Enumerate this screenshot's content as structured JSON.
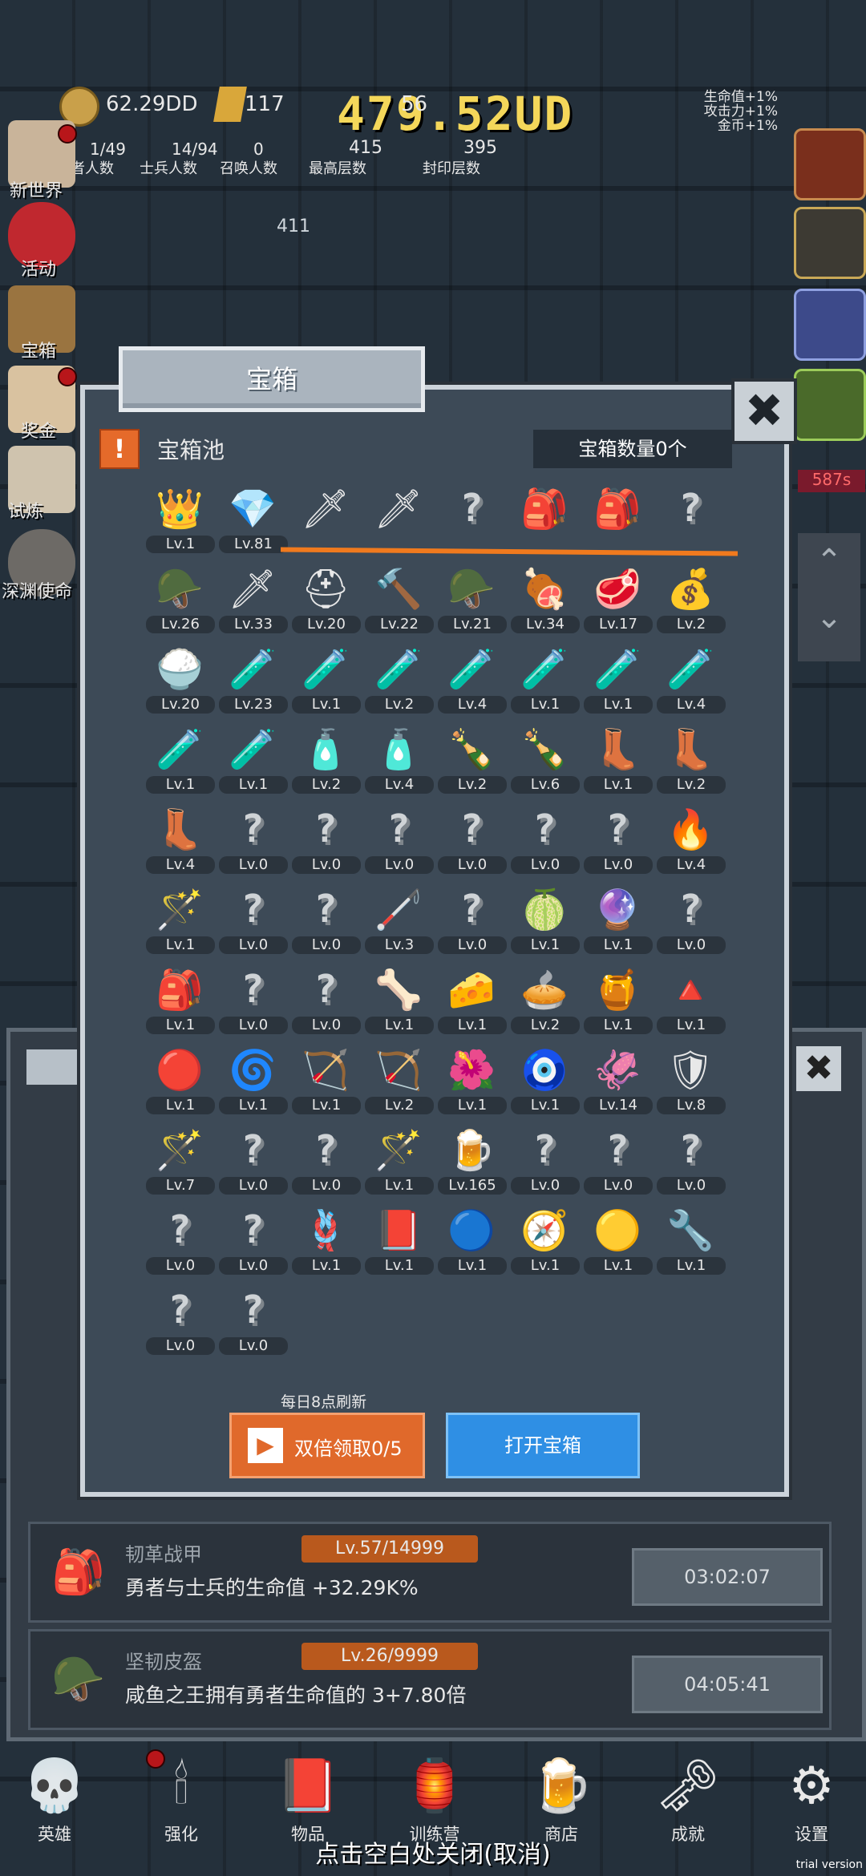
{
  "hud": {
    "damage_title": "479.52UD",
    "gold": "62.29DD",
    "gems": "117",
    "count_56": "56",
    "stats": [
      {
        "value": "1/49",
        "label": "勇者人数"
      },
      {
        "value": "14/94",
        "label": "士兵人数"
      },
      {
        "value": "0",
        "label": "召唤人数"
      },
      {
        "value": "415",
        "label": "最高层数"
      },
      {
        "value": "395",
        "label": "封印层数"
      }
    ],
    "bonus": [
      "生命值+1%",
      "攻击力+1%",
      "金币+1%"
    ],
    "floor_num": "411",
    "timer_587": "587s"
  },
  "sidebar": [
    {
      "label": "新世界",
      "icon": "scroll-map-icon"
    },
    {
      "label": "活动",
      "icon": "heart-icon"
    },
    {
      "label": "宝箱",
      "icon": "chest-icon"
    },
    {
      "label": "奖金",
      "icon": "letter-icon"
    },
    {
      "label": "试炼",
      "icon": "feather-icon"
    },
    {
      "label": "深渊使命",
      "icon": "skull-icon"
    }
  ],
  "dialog": {
    "title": "宝箱",
    "close": "✖",
    "pool_label": "宝箱池",
    "pool_count": "宝箱数量0个",
    "refresh_note": "每日8点刷新",
    "double_button": "双倍领取0/5",
    "open_button": "打开宝箱",
    "items": [
      {
        "icon": "👑",
        "lv": "Lv.1"
      },
      {
        "icon": "💎",
        "lv": "Lv.81"
      },
      {
        "icon": "🗡",
        "lv": ""
      },
      {
        "icon": "🗡",
        "lv": ""
      },
      {
        "icon": "?",
        "lv": ""
      },
      {
        "icon": "🎒",
        "lv": ""
      },
      {
        "icon": "🎒",
        "lv": ""
      },
      {
        "icon": "?",
        "lv": ""
      },
      {
        "icon": "🪖",
        "lv": "Lv.26"
      },
      {
        "icon": "🗡",
        "lv": "Lv.33"
      },
      {
        "icon": "⛑",
        "lv": "Lv.20"
      },
      {
        "icon": "🔨",
        "lv": "Lv.22"
      },
      {
        "icon": "🪖",
        "lv": "Lv.21"
      },
      {
        "icon": "🍖",
        "lv": "Lv.34"
      },
      {
        "icon": "🥩",
        "lv": "Lv.17"
      },
      {
        "icon": "💰",
        "lv": "Lv.2"
      },
      {
        "icon": "🍚",
        "lv": "Lv.20"
      },
      {
        "icon": "🧪",
        "lv": "Lv.23"
      },
      {
        "icon": "🧪",
        "lv": "Lv.1"
      },
      {
        "icon": "🧪",
        "lv": "Lv.2"
      },
      {
        "icon": "🧪",
        "lv": "Lv.4"
      },
      {
        "icon": "🧪",
        "lv": "Lv.1"
      },
      {
        "icon": "🧪",
        "lv": "Lv.1"
      },
      {
        "icon": "🧪",
        "lv": "Lv.4"
      },
      {
        "icon": "🧪",
        "lv": "Lv.1"
      },
      {
        "icon": "🧪",
        "lv": "Lv.1"
      },
      {
        "icon": "🧴",
        "lv": "Lv.2"
      },
      {
        "icon": "🧴",
        "lv": "Lv.4"
      },
      {
        "icon": "🍾",
        "lv": "Lv.2"
      },
      {
        "icon": "🍾",
        "lv": "Lv.6"
      },
      {
        "icon": "👢",
        "lv": "Lv.1"
      },
      {
        "icon": "👢",
        "lv": "Lv.2"
      },
      {
        "icon": "👢",
        "lv": "Lv.4"
      },
      {
        "icon": "?",
        "lv": "Lv.0"
      },
      {
        "icon": "?",
        "lv": "Lv.0"
      },
      {
        "icon": "?",
        "lv": "Lv.0"
      },
      {
        "icon": "?",
        "lv": "Lv.0"
      },
      {
        "icon": "?",
        "lv": "Lv.0"
      },
      {
        "icon": "?",
        "lv": "Lv.0"
      },
      {
        "icon": "🔥",
        "lv": "Lv.4"
      },
      {
        "icon": "🪄",
        "lv": "Lv.1"
      },
      {
        "icon": "?",
        "lv": "Lv.0"
      },
      {
        "icon": "?",
        "lv": "Lv.0"
      },
      {
        "icon": "🦯",
        "lv": "Lv.3"
      },
      {
        "icon": "?",
        "lv": "Lv.0"
      },
      {
        "icon": "🍈",
        "lv": "Lv.1"
      },
      {
        "icon": "🔮",
        "lv": "Lv.1"
      },
      {
        "icon": "?",
        "lv": "Lv.0"
      },
      {
        "icon": "🎒",
        "lv": "Lv.1"
      },
      {
        "icon": "?",
        "lv": "Lv.0"
      },
      {
        "icon": "?",
        "lv": "Lv.0"
      },
      {
        "icon": "🦴",
        "lv": "Lv.1"
      },
      {
        "icon": "🧀",
        "lv": "Lv.1"
      },
      {
        "icon": "🥧",
        "lv": "Lv.2"
      },
      {
        "icon": "🍯",
        "lv": "Lv.1"
      },
      {
        "icon": "🔺",
        "lv": "Lv.1"
      },
      {
        "icon": "🔴",
        "lv": "Lv.1"
      },
      {
        "icon": "🌀",
        "lv": "Lv.1"
      },
      {
        "icon": "🏹",
        "lv": "Lv.1"
      },
      {
        "icon": "🏹",
        "lv": "Lv.2"
      },
      {
        "icon": "🌺",
        "lv": "Lv.1"
      },
      {
        "icon": "🧿",
        "lv": "Lv.1"
      },
      {
        "icon": "🦑",
        "lv": "Lv.14"
      },
      {
        "icon": "🛡",
        "lv": "Lv.8"
      },
      {
        "icon": "🪄",
        "lv": "Lv.7"
      },
      {
        "icon": "?",
        "lv": "Lv.0"
      },
      {
        "icon": "?",
        "lv": "Lv.0"
      },
      {
        "icon": "🪄",
        "lv": "Lv.1"
      },
      {
        "icon": "🍺",
        "lv": "Lv.165"
      },
      {
        "icon": "?",
        "lv": "Lv.0"
      },
      {
        "icon": "?",
        "lv": "Lv.0"
      },
      {
        "icon": "?",
        "lv": "Lv.0"
      },
      {
        "icon": "?",
        "lv": "Lv.0"
      },
      {
        "icon": "?",
        "lv": "Lv.0"
      },
      {
        "icon": "🪢",
        "lv": "Lv.1"
      },
      {
        "icon": "📕",
        "lv": "Lv.1"
      },
      {
        "icon": "🔵",
        "lv": "Lv.1"
      },
      {
        "icon": "🧭",
        "lv": "Lv.1"
      },
      {
        "icon": "🟡",
        "lv": "Lv.1"
      },
      {
        "icon": "🔧",
        "lv": "Lv.1"
      },
      {
        "icon": "?",
        "lv": "Lv.0"
      },
      {
        "icon": "?",
        "lv": "Lv.0"
      }
    ]
  },
  "panel_rows": [
    {
      "name": "韧革战甲",
      "level": "Lv.57/14999",
      "desc": "勇者与士兵的生命值 +32.29K%",
      "timer": "03:02:07",
      "icon": "🎒"
    },
    {
      "name": "坚韧皮盔",
      "level": "Lv.26/9999",
      "desc": "咸鱼之王拥有勇者生命值的 3+7.80倍",
      "timer": "04:05:41",
      "icon": "🪖"
    }
  ],
  "nav": [
    {
      "label": "英雄",
      "icon": "💀"
    },
    {
      "label": "强化",
      "icon": "🕯"
    },
    {
      "label": "物品",
      "icon": "📕"
    },
    {
      "label": "训练营",
      "icon": "🏮"
    },
    {
      "label": "商店",
      "icon": "🍺"
    },
    {
      "label": "成就",
      "icon": "🗝"
    },
    {
      "label": "设置",
      "icon": "⚙"
    }
  ],
  "close_hint": "点击空白处关闭(取消)",
  "watermark": "trial version"
}
